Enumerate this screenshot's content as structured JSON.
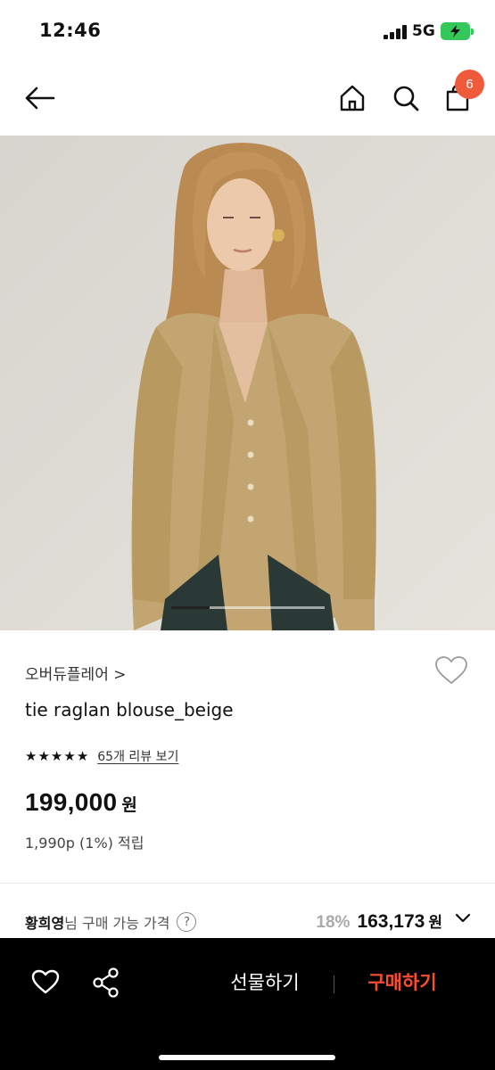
{
  "status_bar": {
    "time": "12:46",
    "network": "5G",
    "battery_color": "#34c759"
  },
  "nav": {
    "back_icon": "arrow-left-icon",
    "home_icon": "home-icon",
    "search_icon": "search-icon",
    "cart_icon": "shopping-bag-icon",
    "cart_count": "6",
    "badge_color": "#ef5a3b"
  },
  "image": {
    "slide_index": 1,
    "slide_total": 4
  },
  "product": {
    "brand": "오버듀플레어 >",
    "name": "tie raglan blouse_beige",
    "rating_stars": 5,
    "review_link": "65개 리뷰 보기",
    "price": "199,000",
    "price_unit": "원",
    "points": "1,990p (1%) 적립"
  },
  "member_price": {
    "name": "황희영",
    "label_suffix": "님 구매 가능 가격",
    "help": "?",
    "discount": "18%",
    "amount": "163,173",
    "unit": "원"
  },
  "bottom_bar": {
    "gift_label": "선물하기",
    "buy_label": "구매하기",
    "buy_color": "#ff4c2e"
  }
}
